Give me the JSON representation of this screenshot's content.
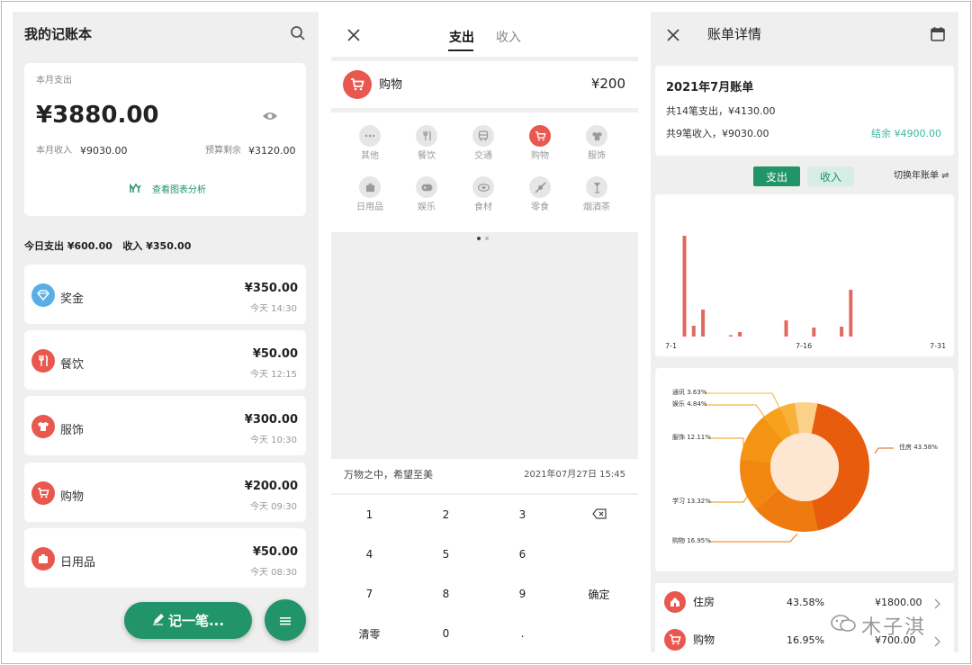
{
  "colors": {
    "accent": "#22946a",
    "expense_red": "#e8584f",
    "bar": "#e06a5f",
    "donut_dark": "#e85c0d",
    "donut_light": "#f7a21b",
    "balance_teal": "#3cb8a0"
  },
  "left": {
    "title": "我的记账本",
    "summary": {
      "label": "本月支出",
      "amount": "¥3880.00",
      "income_label": "本月收入",
      "income": "¥9030.00",
      "budget_label": "预算剩余",
      "budget": "¥3120.00",
      "chart_link": "查看图表分析"
    },
    "today": "今日支出 ¥600.00   收入 ¥350.00",
    "transactions": [
      {
        "name": "奖金",
        "amount": "¥350.00",
        "time": "今天 14:30",
        "icon": "bonus-icon",
        "color": "#5aaee6"
      },
      {
        "name": "餐饮",
        "amount": "¥50.00",
        "time": "今天 12:15",
        "icon": "dining-icon",
        "color": "#e8584f"
      },
      {
        "name": "服饰",
        "amount": "¥300.00",
        "time": "今天 10:30",
        "icon": "clothing-icon",
        "color": "#e8584f"
      },
      {
        "name": "购物",
        "amount": "¥200.00",
        "time": "今天 09:30",
        "icon": "cart-icon",
        "color": "#e8584f"
      },
      {
        "name": "日用品",
        "amount": "¥50.00",
        "time": "今天 08:30",
        "icon": "daily-goods-icon",
        "color": "#e8584f"
      }
    ],
    "fab_label": "记一笔...",
    "menu_icon": "menu-icon"
  },
  "middle": {
    "tabs": [
      "支出",
      "收入"
    ],
    "selected": {
      "name": "购物",
      "amount": "¥200"
    },
    "categories": [
      {
        "label": "其他",
        "icon": "more-icon"
      },
      {
        "label": "餐饮",
        "icon": "dining-icon"
      },
      {
        "label": "交通",
        "icon": "bus-icon"
      },
      {
        "label": "购物",
        "icon": "cart-icon"
      },
      {
        "label": "服饰",
        "icon": "clothing-icon"
      },
      {
        "label": "日用品",
        "icon": "daily-goods-icon"
      },
      {
        "label": "娱乐",
        "icon": "game-icon"
      },
      {
        "label": "食材",
        "icon": "food-icon"
      },
      {
        "label": "零食",
        "icon": "candy-icon"
      },
      {
        "label": "烟酒茶",
        "icon": "glass-icon"
      }
    ],
    "note": "万物之中，希望至美",
    "datetime": "2021年07月27日 15:45",
    "keys": [
      "1",
      "2",
      "3",
      "⌫",
      "4",
      "5",
      "6",
      "",
      "7",
      "8",
      "9",
      "确定",
      "清零",
      "0",
      ".",
      ""
    ]
  },
  "right": {
    "title": "账单详情",
    "bill": {
      "title": "2021年7月账单",
      "expense_line": "共14笔支出，¥4130.00",
      "income_line": "共9笔收入，¥9030.00",
      "balance": "结余 ¥4900.00"
    },
    "toggle": {
      "expense": "支出",
      "income": "收入",
      "switch": "切换年账单 ⇌"
    },
    "chart_data": [
      {
        "type": "bar",
        "x_ticks": [
          "7-1",
          "7-16",
          "7-31"
        ],
        "bars": [
          {
            "day": 3,
            "value": 112
          },
          {
            "day": 4,
            "value": 12
          },
          {
            "day": 5,
            "value": 30
          },
          {
            "day": 8,
            "value": 1
          },
          {
            "day": 9,
            "value": 5
          },
          {
            "day": 14,
            "value": 18
          },
          {
            "day": 17,
            "value": 10
          },
          {
            "day": 20,
            "value": 11
          },
          {
            "day": 21,
            "value": 52
          }
        ]
      },
      {
        "type": "pie",
        "donut": true,
        "slices": [
          {
            "label": "住房",
            "value": 43.58,
            "text": "住房 43.58%",
            "color": "#e85c0d"
          },
          {
            "label": "购物",
            "value": 16.95,
            "text": "购物 16.95%",
            "color": "#ef7a0f"
          },
          {
            "label": "学习",
            "value": 13.32,
            "text": "学习 13.32%",
            "color": "#f2870f"
          },
          {
            "label": "服饰",
            "value": 12.11,
            "text": "服饰 12.11%",
            "color": "#f49414"
          },
          {
            "label": "娱乐",
            "value": 4.84,
            "text": "娱乐 4.84%",
            "color": "#f6a21d"
          },
          {
            "label": "通讯",
            "value": 3.63,
            "text": "通讯 3.63%",
            "color": "#f8b23b"
          },
          {
            "label": "",
            "value": 5.57,
            "color": "#fbd089"
          }
        ]
      }
    ],
    "rows": [
      {
        "name": "住房",
        "percent": "43.58%",
        "amount": "¥1800.00"
      },
      {
        "name": "购物",
        "percent": "16.95%",
        "amount": "¥700.00"
      }
    ],
    "watermark": "木子淇"
  }
}
